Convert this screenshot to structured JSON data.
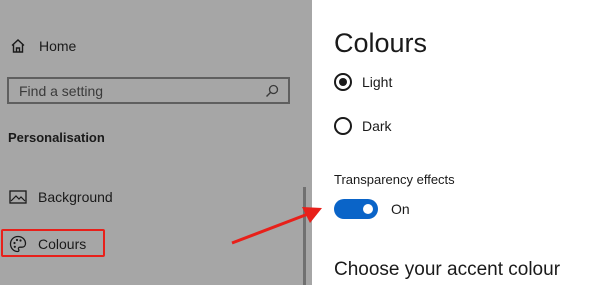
{
  "sidebar": {
    "home_label": "Home",
    "search_placeholder": "Find a setting",
    "section_title": "Personalisation",
    "items": [
      {
        "label": "Background",
        "icon": "picture-icon"
      },
      {
        "label": "Colours",
        "icon": "palette-icon",
        "highlighted": true
      }
    ]
  },
  "content": {
    "title": "Colours",
    "mode_options": [
      {
        "label": "Light",
        "selected": true
      },
      {
        "label": "Dark",
        "selected": false
      }
    ],
    "transparency": {
      "label": "Transparency effects",
      "state_label": "On",
      "enabled": true
    },
    "accent_heading": "Choose your accent colour"
  },
  "colors": {
    "accent": "#0a64c8",
    "annotation": "#e8201a",
    "sidebar_bg": "#a6a6a6"
  },
  "annotation": {
    "type": "arrow",
    "points_to": "transparency-toggle"
  }
}
